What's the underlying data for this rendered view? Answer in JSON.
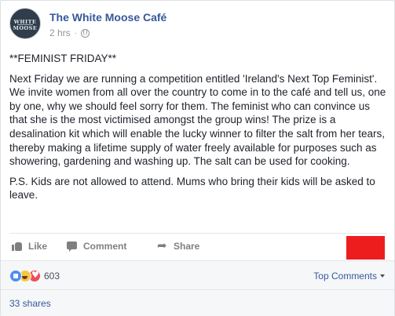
{
  "post": {
    "page_name": "The White Moose Café",
    "avatar_text_1": "WHITE",
    "avatar_text_2": "MOOSE",
    "time": "2 hrs",
    "separator": "·",
    "privacy_icon": "globe-icon",
    "paragraphs": [
      "**FEMINIST FRIDAY**",
      "Next Friday we are running a competition entitled 'Ireland's Next Top Feminist'. We invite women from all over the country to come in to the café and tell us, one by one, why we should feel sorry for them. The feminist who can convince us that she is the most victimised amongst the group wins! The prize is a desalination kit which will enable the lucky winner to filter the salt from her tears, thereby making a lifetime supply of water freely available for purposes such as showering, gardening and washing up. The salt can be used for cooking.",
      "P.S. Kids are not allowed to attend. Mums who bring their kids will be asked to leave."
    ]
  },
  "actions": {
    "like": "Like",
    "comment": "Comment",
    "share": "Share"
  },
  "reactions": {
    "icons": [
      "like-reaction-icon",
      "haha-reaction-icon",
      "love-reaction-icon"
    ],
    "count": "603",
    "top_comments": "Top Comments"
  },
  "shares": "33 shares",
  "colors": {
    "link_blue": "#365899",
    "redaction_red": "#ee1d1d"
  }
}
